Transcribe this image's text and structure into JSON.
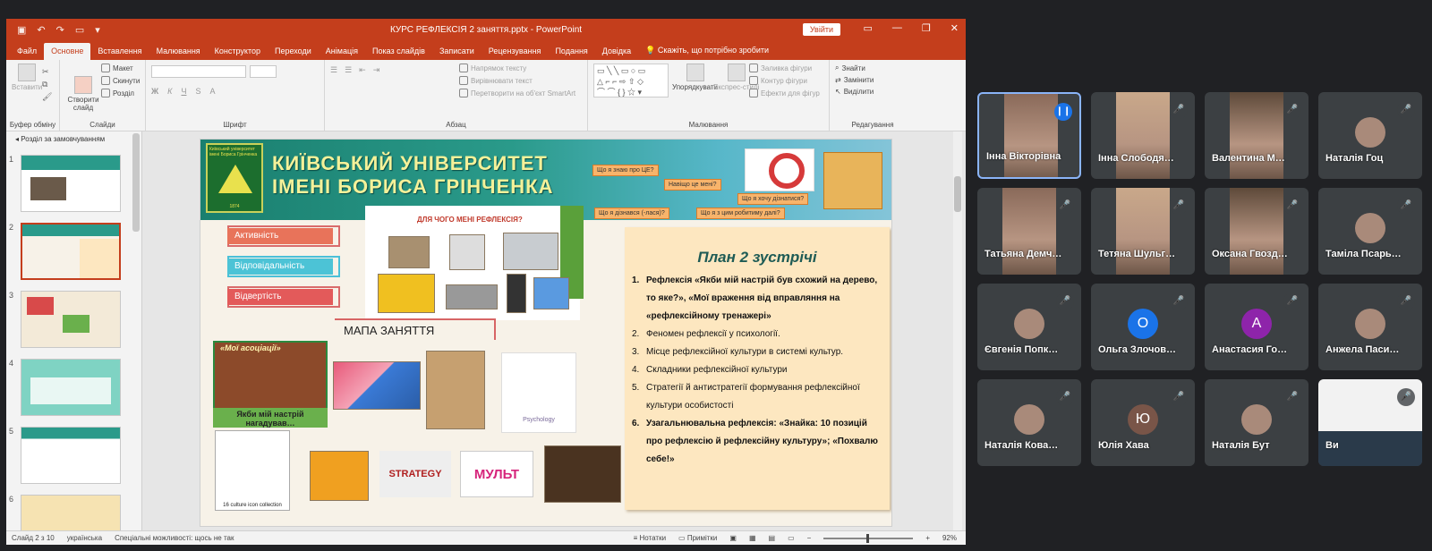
{
  "window": {
    "title": "КУРС РЕФЛЕКСІЯ 2 заняття.pptx  -  PowerPoint",
    "signin": "Увійти"
  },
  "ribbon_tabs": [
    "Файл",
    "Основне",
    "Вставлення",
    "Малювання",
    "Конструктор",
    "Переходи",
    "Анімація",
    "Показ слайдів",
    "Записати",
    "Рецензування",
    "Подання",
    "Довідка"
  ],
  "tell_me": "Скажіть, що потрібно зробити",
  "ribbon": {
    "clipboard": {
      "paste": "Вставити",
      "label": "Буфер обміну"
    },
    "slides": {
      "new": "Створити слайд",
      "layout": "Макет",
      "reset": "Скинути",
      "section": "Розділ",
      "label": "Слайди"
    },
    "font": {
      "label": "Шрифт"
    },
    "paragraph": {
      "direction": "Напрямок тексту",
      "align": "Вирівнювати текст",
      "smartart": "Перетворити на об'єкт SmartArt",
      "label": "Абзац"
    },
    "drawing": {
      "arrange": "Упорядкувати",
      "styles": "Експрес-стилі",
      "fill": "Заливка фігури",
      "outline": "Контур фігури",
      "effects": "Ефекти для фігур",
      "label": "Малювання"
    },
    "editing": {
      "find": "Знайти",
      "replace": "Замінити",
      "select": "Виділити",
      "label": "Редагування"
    }
  },
  "thumbnails": {
    "section_header": "Розділ за замовчуванням",
    "numbers": [
      "1",
      "2",
      "3",
      "4",
      "5",
      "6"
    ],
    "selected": "2"
  },
  "slide": {
    "university_line1": "КИЇВСЬКИЙ УНІВЕРСИТЕТ",
    "university_line2": "ІМЕНІ БОРИСА ГРІНЧЕНКА",
    "logo_text": "Київський університет імені Бориса Грінченка",
    "logo_year": "1874",
    "questions": [
      "Що я знаю про ЦЕ?",
      "Навіщо це мені?",
      "Що я хочу дізнатися?",
      "Що я дізнався (-лася)?",
      "Що я з цим робитиму далі?"
    ],
    "why_title": "ДЛЯ ЧОГО МЕНІ РЕФЛЕКСІЯ?",
    "labels": [
      "Активність",
      "Відповідальність",
      "Відвертість"
    ],
    "map_title": "МАПА ЗАНЯТТЯ",
    "assoc_title": "«Мої асоціації»",
    "assoc_caption": "Якби мій настрій нагадував…",
    "icons_caption": "16 culture icon collection",
    "psy_caption": "Psychology",
    "strategy_text": "STRATEGY",
    "mult_text": "МУЛЬТ",
    "plan_title": "План 2 зустрічі",
    "plan_items": [
      {
        "n": "1.",
        "text": "Рефлексія  «Якби мій настрій був схожий на дерево, то яке?», «Мої враження від вправляння на «рефлексійному тренажері»",
        "bold": true
      },
      {
        "n": "2.",
        "text": "Феномен рефлексії у психології.",
        "bold": false
      },
      {
        "n": "3.",
        "text": "Місце рефлексійної культури в системі культур.",
        "bold": false
      },
      {
        "n": "4.",
        "text": "Складники рефлексійної культури",
        "bold": false
      },
      {
        "n": "5.",
        "text": "Стратегії й антистратегії формування рефлексійної культури особистості",
        "bold": false
      },
      {
        "n": "6.",
        "text": "Узагальнювальна рефлексія: «Знайка: 10 позицій про рефлексію й рефлексійну культуру»; «Похвалю себе!»",
        "bold": true
      }
    ]
  },
  "statusbar": {
    "slide_of": "Слайд 2 з 10",
    "language": "українська",
    "accessibility": "Спеціальні можливості: щось не так",
    "notes": "Нотатки",
    "comments": "Примітки",
    "zoom": "92%"
  },
  "participants": [
    {
      "name": "Інна Вікторівна",
      "type": "video",
      "speaking": true
    },
    {
      "name": "Інна Слободя…",
      "type": "video",
      "speaking": false
    },
    {
      "name": "Валентина М…",
      "type": "video",
      "speaking": false
    },
    {
      "name": "Наталія Гоц",
      "type": "photo",
      "speaking": false
    },
    {
      "name": "Татьяна Демч…",
      "type": "video",
      "speaking": false
    },
    {
      "name": "Тетяна Шульг…",
      "type": "video",
      "speaking": false
    },
    {
      "name": "Оксана Гвозд…",
      "type": "video",
      "speaking": false
    },
    {
      "name": "Таміла Псарь…",
      "type": "photo",
      "speaking": false
    },
    {
      "name": "Євгенія Попк…",
      "type": "photo",
      "speaking": false
    },
    {
      "name": "Ольга Злочов…",
      "type": "letter",
      "letter": "О",
      "color": "#1a73e8",
      "speaking": false
    },
    {
      "name": "Анастасия Го…",
      "type": "letter",
      "letter": "А",
      "color": "#8e24aa",
      "speaking": false
    },
    {
      "name": "Анжела Паси…",
      "type": "photo",
      "speaking": false
    },
    {
      "name": "Наталія Кова…",
      "type": "photo",
      "speaking": false
    },
    {
      "name": "Юлія Хава",
      "type": "letter",
      "letter": "Ю",
      "color": "#795548",
      "speaking": false
    },
    {
      "name": "Наталія Бут",
      "type": "photo",
      "speaking": false
    },
    {
      "name": "Ви",
      "type": "video",
      "speaking": false
    }
  ],
  "colors": {
    "accent": "#c43e1c",
    "speaking": "#8ab4f8",
    "tile": "#3c4043"
  }
}
